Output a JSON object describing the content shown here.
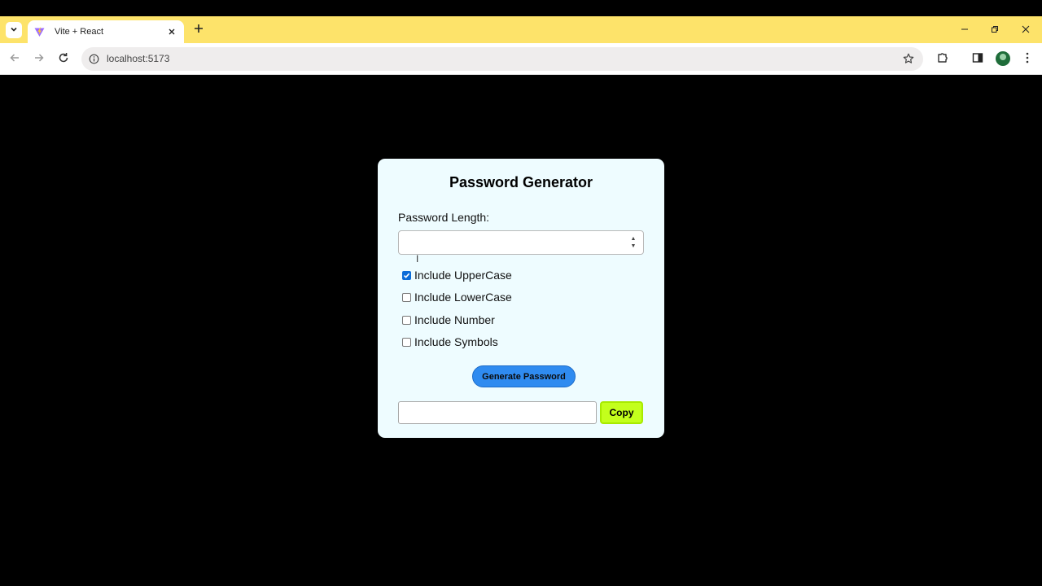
{
  "browser": {
    "tab_title": "Vite + React",
    "url": "localhost:5173"
  },
  "icons": {
    "tab_search": "chevron-down-icon",
    "favicon": "vite-logo-icon",
    "tab_close": "close-icon",
    "new_tab": "plus-icon",
    "minimize": "minimize-icon",
    "restore": "restore-icon",
    "close_window": "close-icon",
    "back": "back-arrow-icon",
    "forward": "forward-arrow-icon",
    "reload": "reload-icon",
    "site_info": "info-icon",
    "bookmark": "star-icon",
    "extensions": "puzzle-icon",
    "side_panel": "side-panel-icon",
    "menu": "kebab-menu-icon"
  },
  "app": {
    "title": "Password Generator",
    "length_label": "Password Length:",
    "length_value": "",
    "options": [
      {
        "label": "Include UpperCase",
        "checked": true
      },
      {
        "label": "Include LowerCase",
        "checked": false
      },
      {
        "label": "Include Number",
        "checked": false
      },
      {
        "label": "Include Symbols",
        "checked": false
      }
    ],
    "generate_label": "Generate Password",
    "output_value": "",
    "copy_label": "Copy"
  },
  "colors": {
    "tabstrip": "#fde36a",
    "card_bg": "#eefcff",
    "generate_bg": "#2f8bf0",
    "copy_bg": "#c3ff1c",
    "checkbox_checked": "#0b6cd8"
  }
}
